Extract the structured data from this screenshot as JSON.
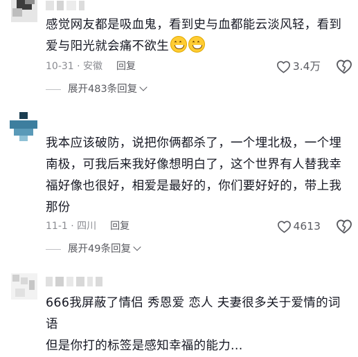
{
  "comments": [
    {
      "text_lines": [
        "感觉网友都是吸血鬼，看到史与血都能云淡风轻，看到",
        "爱与阳光就会痛不欲生"
      ],
      "emoji_count": 2,
      "emoji_icon": "grinning-face-icon",
      "date_location": "10-31 · 安徽",
      "reply_label": "回复",
      "likes": "3.4万",
      "expand_label": "展开483条回复"
    },
    {
      "text_lines": [
        "我本应该破防，说把你俩都杀了，一个埋北极，一个埋",
        "南极，可我后来我好像想明白了，这个世界有人替我幸",
        "福好像也很好，相爱是最好的，你们要好好的，带上我",
        "那份"
      ],
      "date_location": "11-1 · 四川",
      "reply_label": "回复",
      "likes": "4613",
      "expand_label": "展开49条回复"
    },
    {
      "text_lines": [
        "666我屏蔽了情侣 秀恩爱 恋人 夫妻很多关于爱情的词语",
        "但是你打的标签是感知幸福的能力..."
      ]
    }
  ],
  "colors": {
    "text": "#161823",
    "meta": "#8a8b91",
    "action": "#5a5b61"
  }
}
